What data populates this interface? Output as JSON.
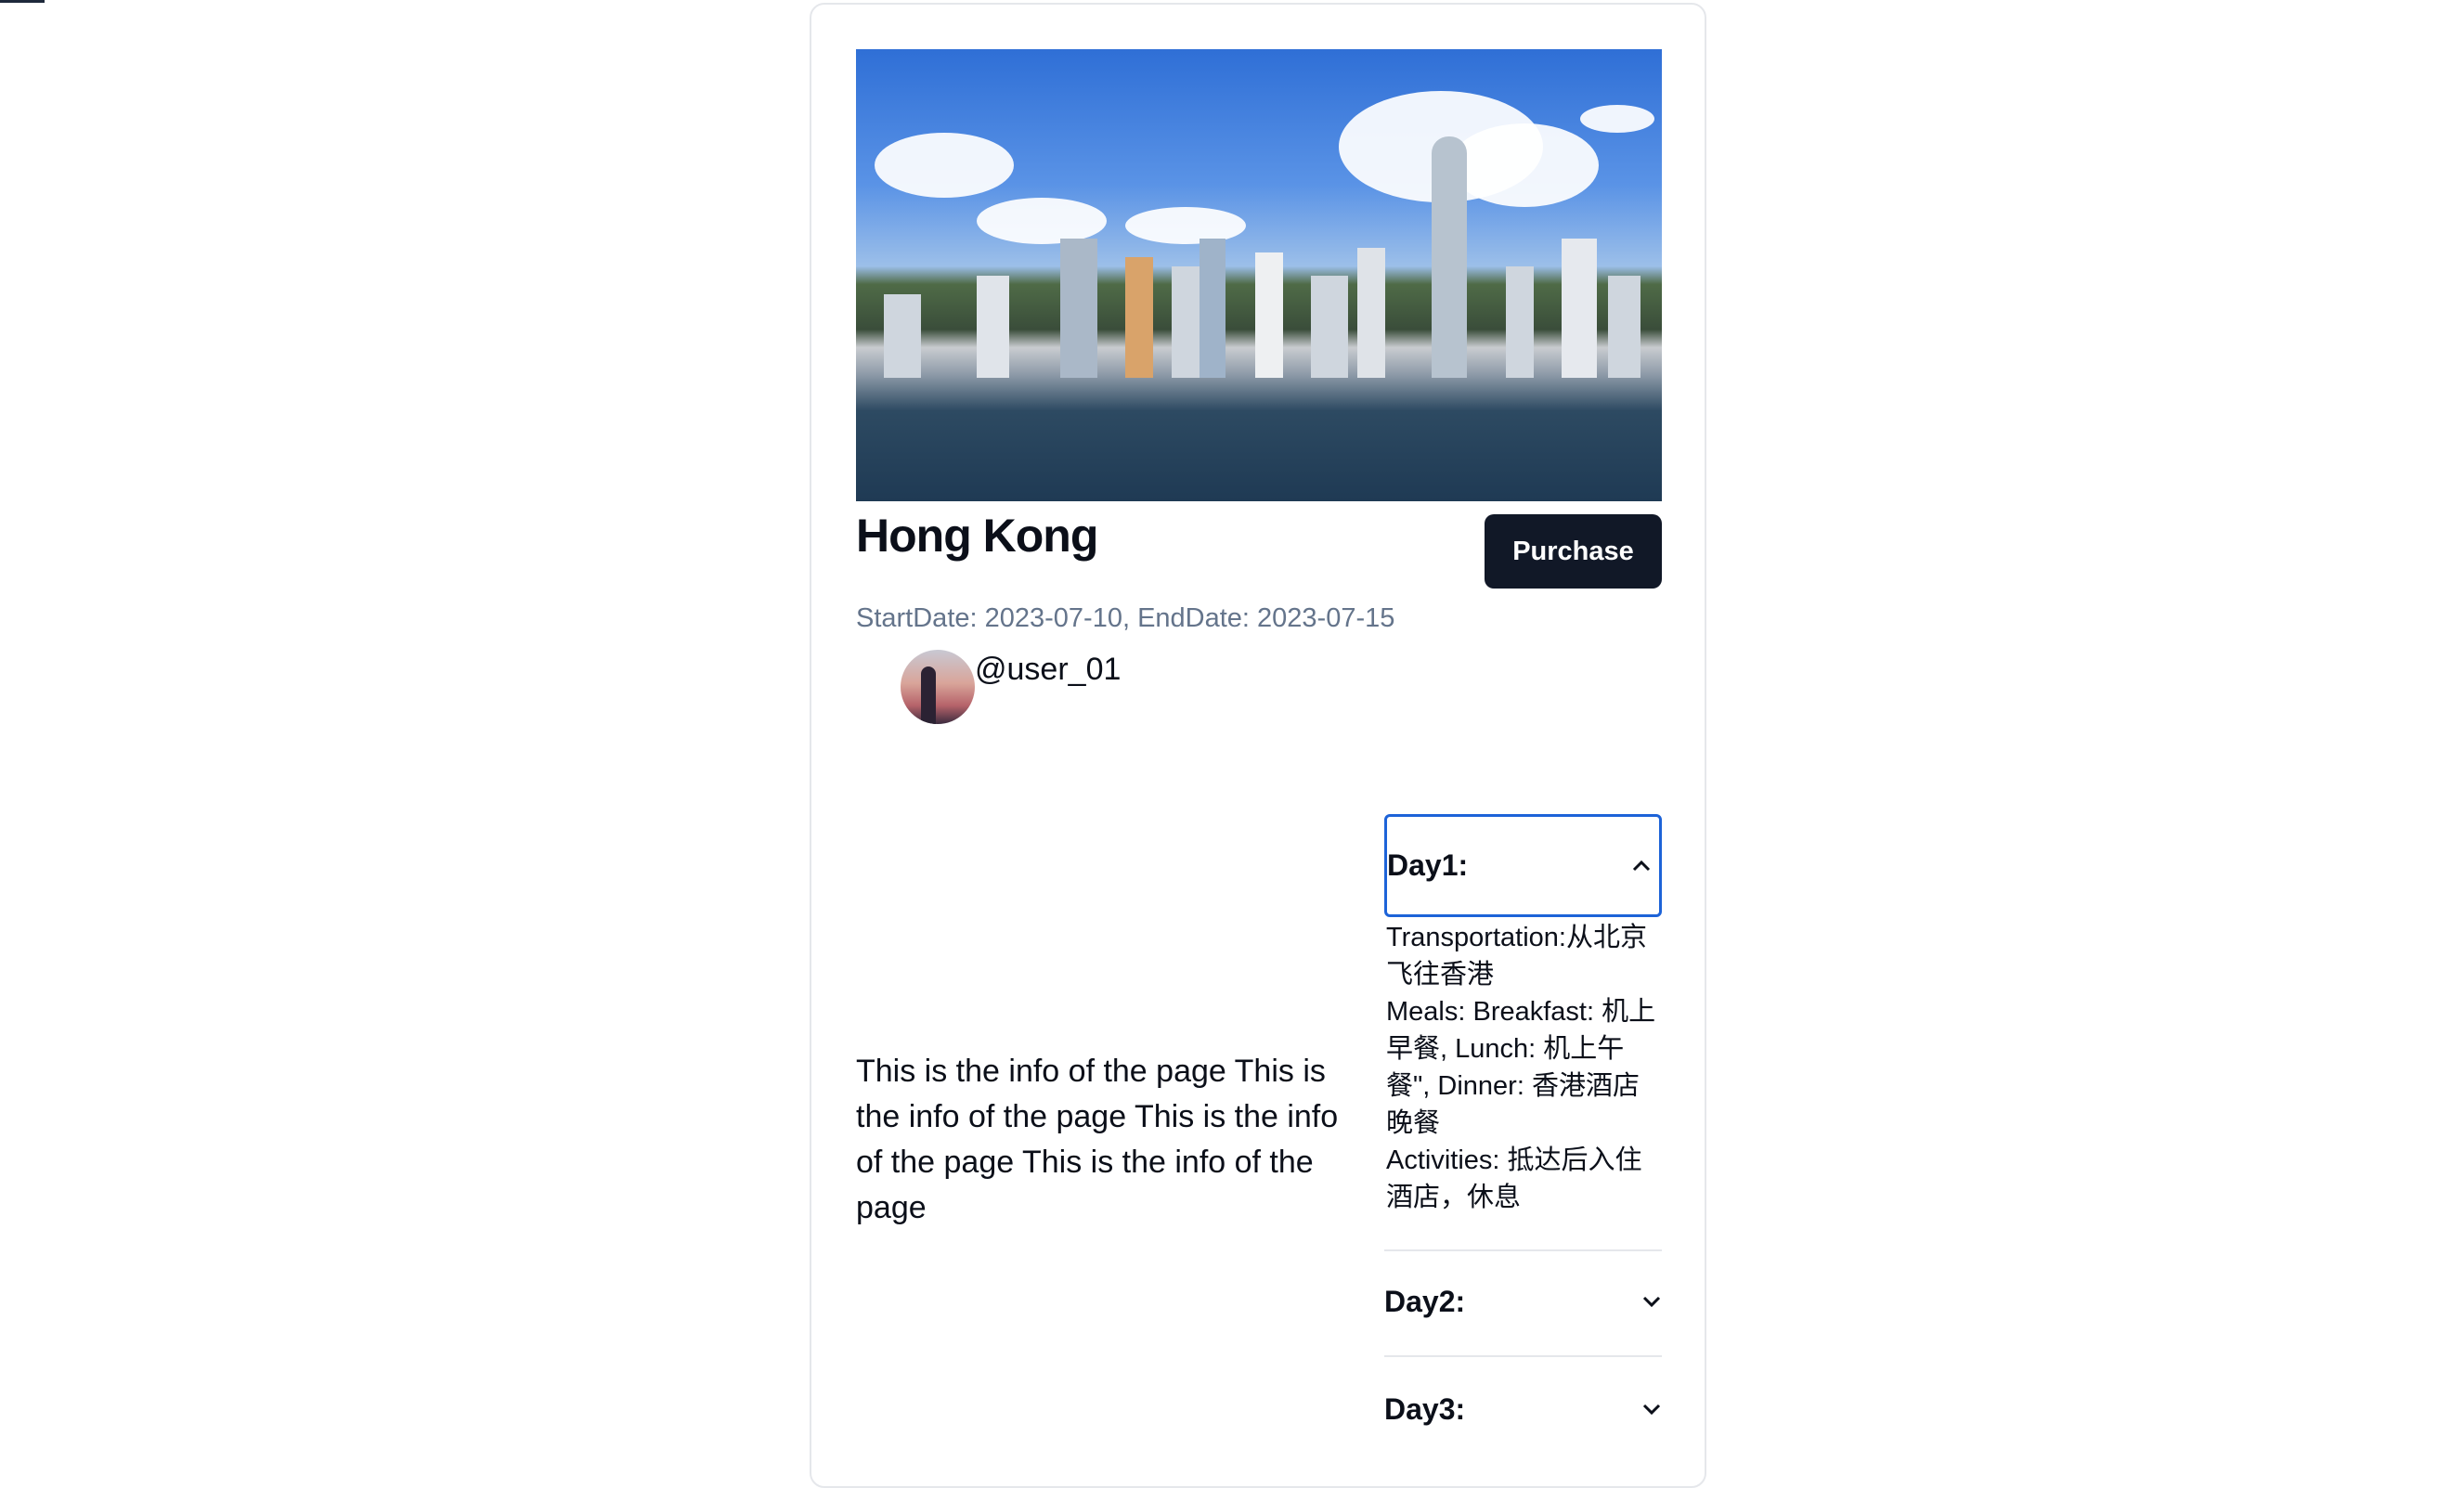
{
  "trip": {
    "title": "Hong Kong",
    "purchase_label": "Purchase",
    "dates": "StartDate: 2023-07-10, EndDate: 2023-07-15",
    "username": "@user_01",
    "description": "This is the info of the page This is the info of the page This is the info of the page This is the info of the page"
  },
  "itinerary": [
    {
      "label": "Day1:",
      "expanded": true,
      "lines": [
        "Transportation:从北京飞往香港",
        "Meals: Breakfast: 机上早餐, Lunch: 机上午餐\", Dinner: 香港酒店晚餐",
        "Activities: 抵达后入住酒店，休息"
      ]
    },
    {
      "label": "Day2:",
      "expanded": false
    },
    {
      "label": "Day3:",
      "expanded": false
    }
  ],
  "colors": {
    "button_bg": "#111827",
    "focus_ring": "#1d63d8",
    "muted_text": "#64748b"
  }
}
